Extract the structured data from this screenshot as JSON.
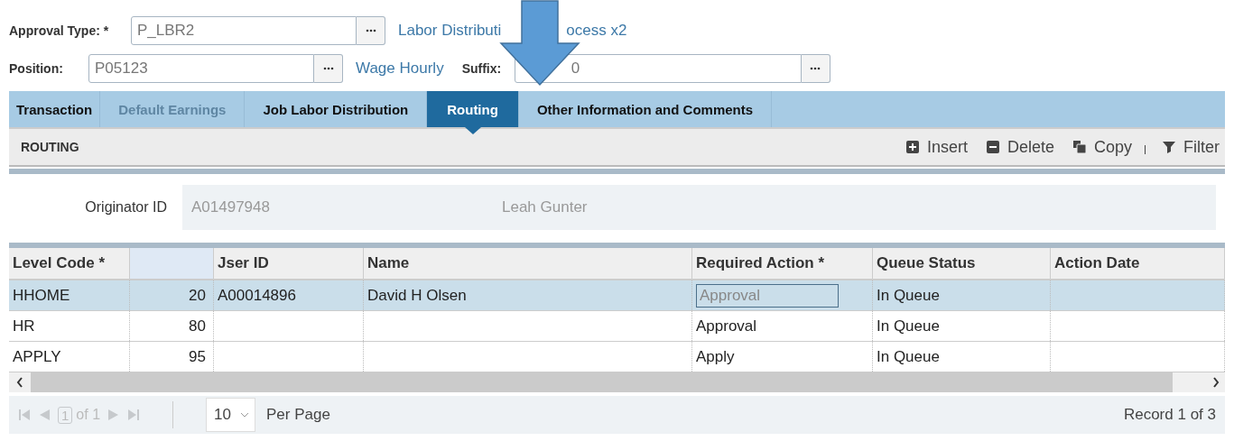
{
  "header": {
    "approval_type": {
      "label": "Approval Type: *",
      "value": "P_LBR2",
      "description_parts": [
        "Labor Distributi",
        "ocess x2"
      ]
    },
    "position": {
      "label": "Position:",
      "value": "P05123",
      "description": "Wage Hourly"
    },
    "suffix": {
      "label": "Suffix:",
      "value": "0"
    }
  },
  "tabs": [
    {
      "label": "Transaction",
      "selected": false,
      "disabled": false
    },
    {
      "label": "Default Earnings",
      "selected": false,
      "disabled": true
    },
    {
      "label": "Job Labor Distribution",
      "selected": false,
      "disabled": false
    },
    {
      "label": "Routing",
      "selected": true,
      "disabled": false
    },
    {
      "label": "Other Information and Comments",
      "selected": false,
      "disabled": false
    }
  ],
  "section": {
    "title": "ROUTING",
    "actions": [
      {
        "kind": "insert",
        "label": "Insert"
      },
      {
        "kind": "delete",
        "label": "Delete"
      },
      {
        "kind": "copy",
        "label": "Copy"
      },
      {
        "kind": "filter",
        "label": "Filter"
      }
    ]
  },
  "originator": {
    "label": "Originator ID",
    "id": "A01497948",
    "name": "Leah Gunter"
  },
  "table": {
    "columns": [
      "Level Code *",
      "",
      "Jser ID",
      "Name",
      "Required Action *",
      "Queue Status",
      "Action Date"
    ],
    "rows": [
      {
        "selected": true,
        "cells": [
          "HHOME",
          "20",
          "A00014896",
          "David H Olsen",
          "Approval",
          "In Queue",
          ""
        ]
      },
      {
        "selected": false,
        "cells": [
          "HR",
          "80",
          "",
          "",
          "Approval",
          "In Queue",
          ""
        ]
      },
      {
        "selected": false,
        "cells": [
          "APPLY",
          "95",
          "",
          "",
          "Apply",
          "In Queue",
          ""
        ]
      }
    ]
  },
  "pager": {
    "page": "1",
    "of": "of 1",
    "per_page": "10",
    "per_page_label": "Per Page",
    "record": "Record 1 of 3"
  }
}
